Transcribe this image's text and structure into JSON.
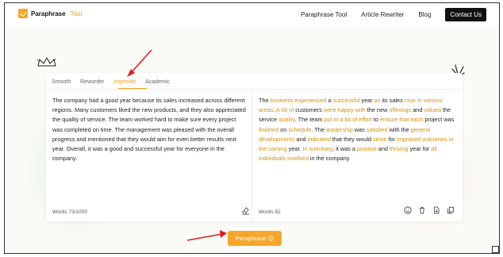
{
  "brand": {
    "name": "Paraphrase",
    "sub": "Tool"
  },
  "nav": {
    "links": [
      "Paraphrase Tool",
      "Article Rewriter",
      "Blog"
    ],
    "contact": "Contact Us"
  },
  "tabs": [
    "Smooth",
    "Reworder",
    "Improver",
    "Academic"
  ],
  "active_tab": "Improver",
  "input": {
    "text": "The company had a good year because its sales increased across different regions. Many customers liked the new products, and they also appreciated the quality of service. The team worked hard to make sure every project was completed on time. The management was pleased with the overall progress and mentioned that they would aim for even better results next year. Overall, it was a good and successful year for everyone in the company.",
    "word_count": "Words 73/1000"
  },
  "output": {
    "segments": [
      {
        "t": "The ",
        "h": false
      },
      {
        "t": "business experienced",
        "h": true
      },
      {
        "t": " a ",
        "h": false
      },
      {
        "t": "successful",
        "h": true
      },
      {
        "t": " year ",
        "h": false
      },
      {
        "t": "as",
        "h": true
      },
      {
        "t": " its sales ",
        "h": false
      },
      {
        "t": "rose in various areas",
        "h": true
      },
      {
        "t": ". ",
        "h": false
      },
      {
        "t": "A lot of",
        "h": true
      },
      {
        "t": " customers ",
        "h": false
      },
      {
        "t": "were happy with",
        "h": true
      },
      {
        "t": " the new ",
        "h": false
      },
      {
        "t": "offerings",
        "h": true
      },
      {
        "t": " and ",
        "h": false
      },
      {
        "t": "valued",
        "h": true
      },
      {
        "t": " the service ",
        "h": false
      },
      {
        "t": "quality",
        "h": true
      },
      {
        "t": ". The team ",
        "h": false
      },
      {
        "t": "put in a lot of effort",
        "h": true
      },
      {
        "t": " to ",
        "h": false
      },
      {
        "t": "ensure that each",
        "h": true
      },
      {
        "t": " project was ",
        "h": false
      },
      {
        "t": "finished",
        "h": true
      },
      {
        "t": " on ",
        "h": false
      },
      {
        "t": "schedule",
        "h": true
      },
      {
        "t": ". The ",
        "h": false
      },
      {
        "t": "leadership",
        "h": true
      },
      {
        "t": " was ",
        "h": false
      },
      {
        "t": "satisfied",
        "h": true
      },
      {
        "t": " with the ",
        "h": false
      },
      {
        "t": "general developments",
        "h": true
      },
      {
        "t": " and ",
        "h": false
      },
      {
        "t": "indicated",
        "h": true
      },
      {
        "t": " that they would ",
        "h": false
      },
      {
        "t": "strive",
        "h": true
      },
      {
        "t": " for ",
        "h": false
      },
      {
        "t": "improved outcomes in the coming",
        "h": true
      },
      {
        "t": " year. ",
        "h": false
      },
      {
        "t": "In summary",
        "h": true
      },
      {
        "t": ", it was a ",
        "h": false
      },
      {
        "t": "positive",
        "h": true
      },
      {
        "t": " and ",
        "h": false
      },
      {
        "t": "thriving",
        "h": true
      },
      {
        "t": " year for ",
        "h": false
      },
      {
        "t": "all individuals involved",
        "h": true
      },
      {
        "t": " in the company.",
        "h": false
      }
    ],
    "word_count": "Words 82"
  },
  "cta": {
    "label": "Paraphrase"
  },
  "colors": {
    "accent": "#f7a62c",
    "highlight": "#d4900c",
    "annotation_arrow": "#e02020"
  },
  "icons": [
    "logo-check-icon",
    "crown-doodle-icon",
    "sparkle-doodle-icon",
    "eraser-icon",
    "smiley-icon",
    "trash-icon",
    "download-icon",
    "copy-icon",
    "info-icon"
  ]
}
